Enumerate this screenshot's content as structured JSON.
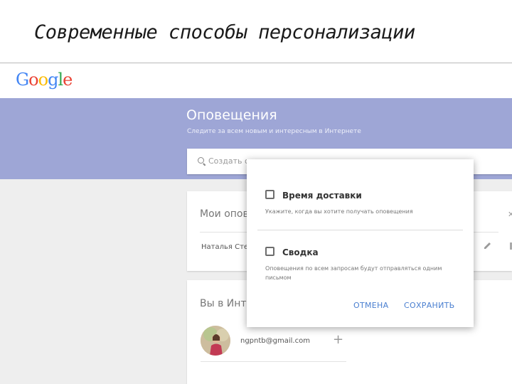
{
  "slide": {
    "title": "Современные способы персонализации"
  },
  "topbar": {
    "logo_letters": [
      "G",
      "o",
      "o",
      "g",
      "l",
      "e"
    ]
  },
  "banner": {
    "title": "Оповещения",
    "subtitle": "Следите за всем новым и интересным в Интернете"
  },
  "search": {
    "placeholder": "Создать оповещение"
  },
  "alerts_card": {
    "heading": "Мои оповещения",
    "row_text": "Наталья Степанова"
  },
  "account_card": {
    "heading": "Вы в Интернете",
    "email": "ngpntb@gmail.com"
  },
  "dialog": {
    "option1": {
      "title": "Время доставки",
      "description": "Укажите, когда вы хотите получать оповещения"
    },
    "option2": {
      "title": "Сводка",
      "description_line1": "Оповещения по всем запросам будут отправляться одним",
      "description_line2": "письмом"
    },
    "cancel_label": "ОТМЕНА",
    "save_label": "СОХРАНИТЬ"
  },
  "colors": {
    "banner": "#9ea6d6",
    "accent_blue": "#4a7fd0",
    "background": "#eeeeee"
  }
}
